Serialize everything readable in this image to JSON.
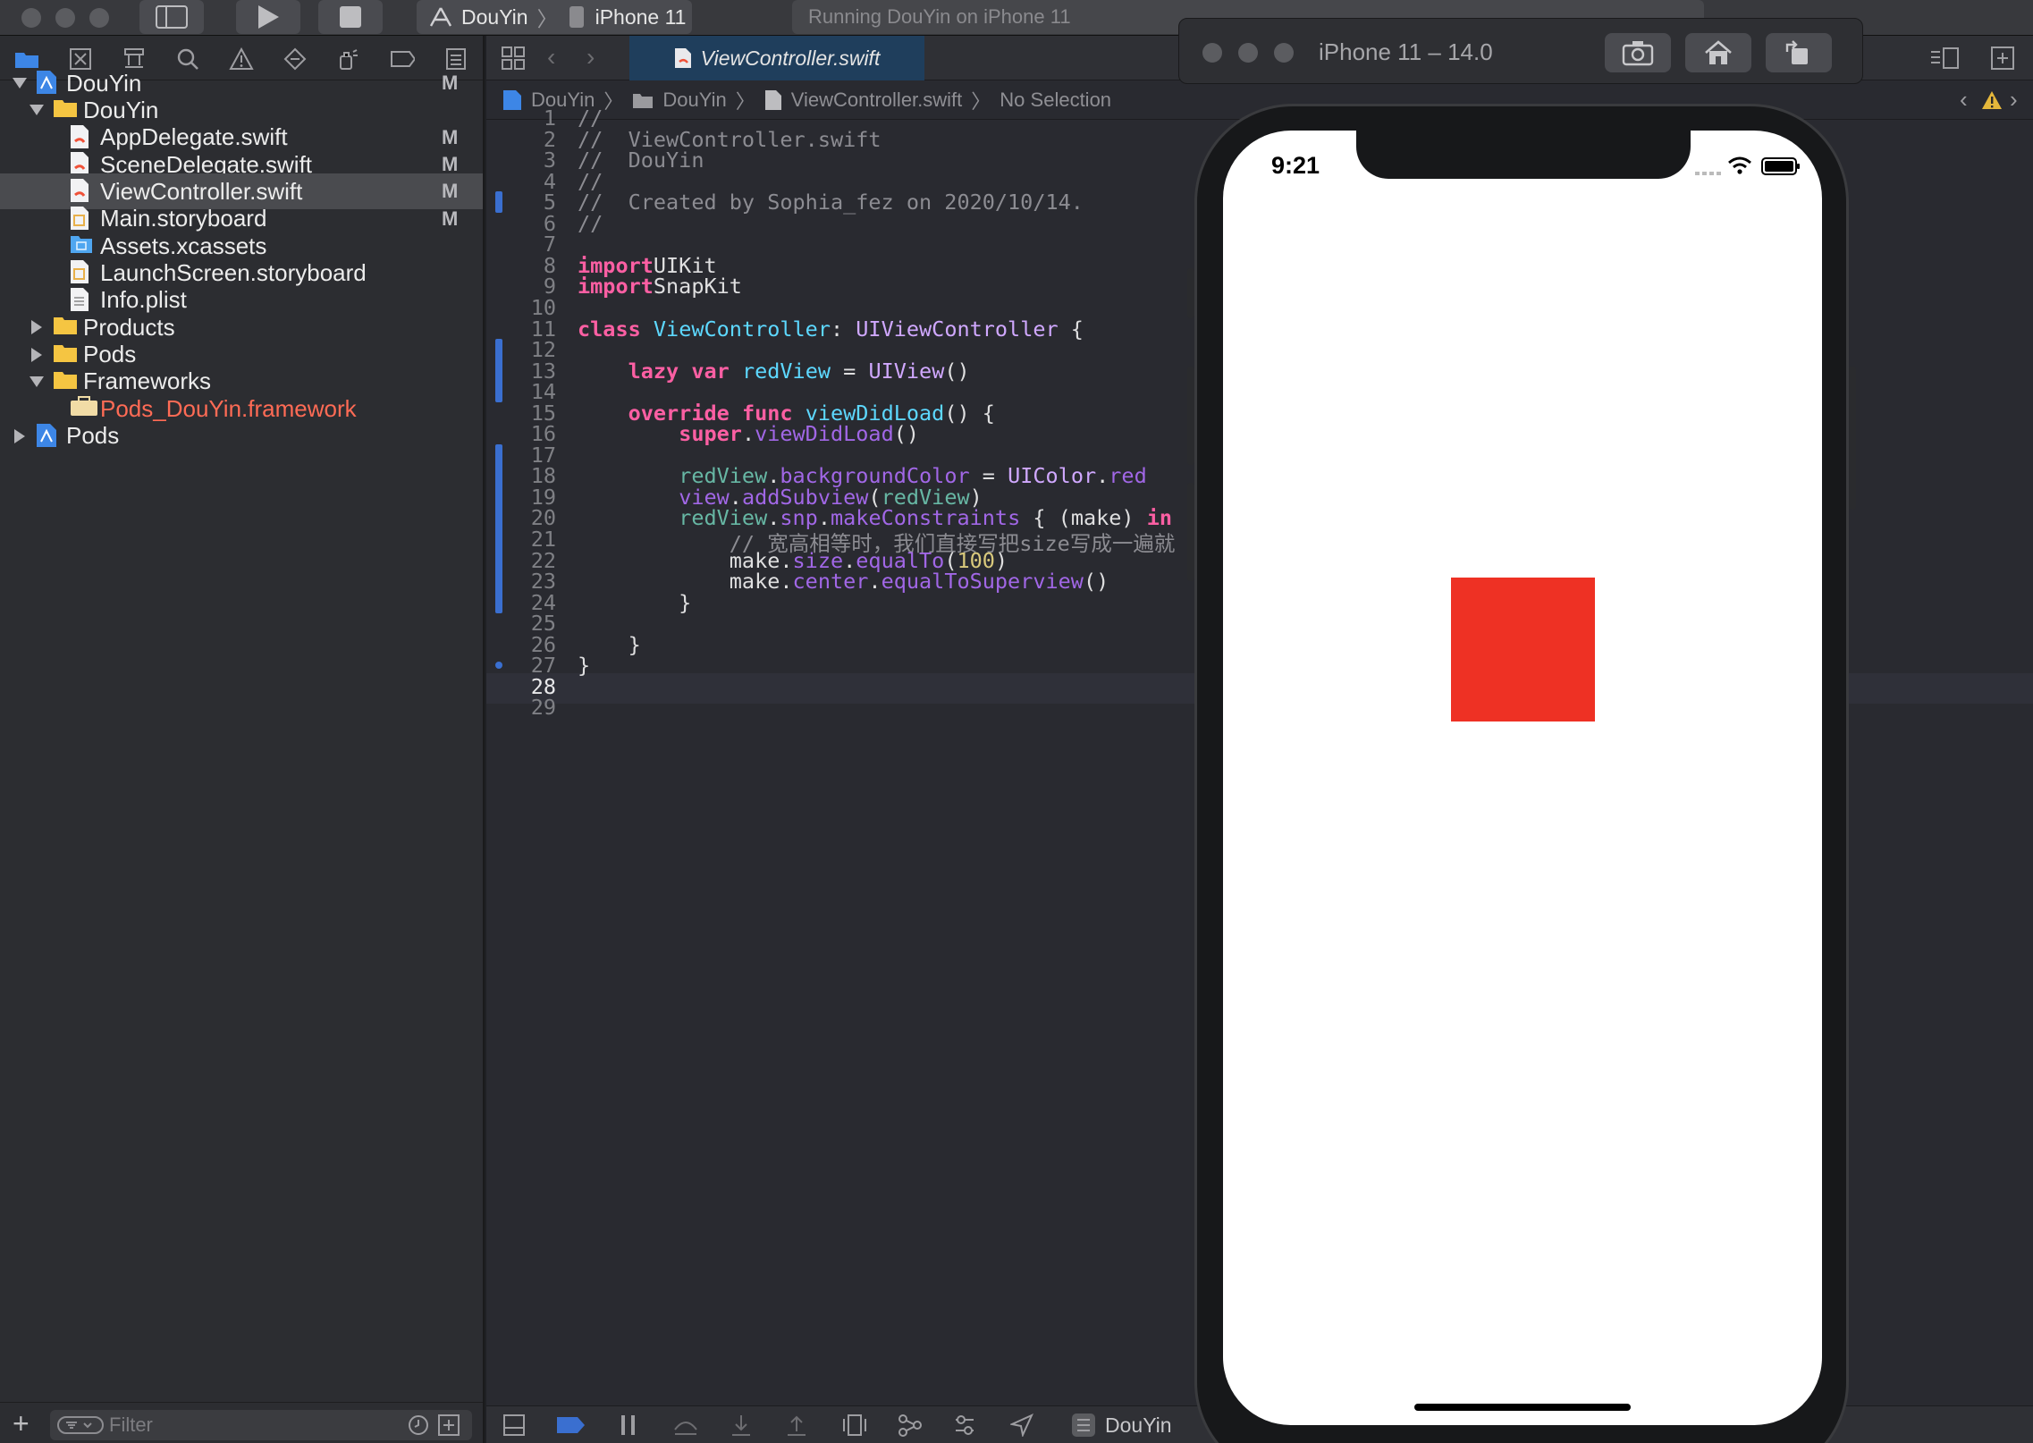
{
  "toolbar": {
    "scheme_project": "DouYin",
    "scheme_device": "iPhone 11",
    "status": "Running DouYin on iPhone 11"
  },
  "navigator": {
    "rows": [
      {
        "label": "DouYin",
        "badge": "M",
        "kind": "project",
        "disclosure": "open"
      },
      {
        "label": "DouYin",
        "badge": "",
        "kind": "folder",
        "disclosure": "open"
      },
      {
        "label": "AppDelegate.swift",
        "badge": "M",
        "kind": "swift",
        "disclosure": ""
      },
      {
        "label": "SceneDelegate.swift",
        "badge": "M",
        "kind": "swift",
        "disclosure": ""
      },
      {
        "label": "ViewController.swift",
        "badge": "M",
        "kind": "swift",
        "disclosure": "",
        "selected": true
      },
      {
        "label": "Main.storyboard",
        "badge": "M",
        "kind": "storyboard",
        "disclosure": ""
      },
      {
        "label": "Assets.xcassets",
        "badge": "",
        "kind": "assets",
        "disclosure": ""
      },
      {
        "label": "LaunchScreen.storyboard",
        "badge": "",
        "kind": "storyboard",
        "disclosure": ""
      },
      {
        "label": "Info.plist",
        "badge": "",
        "kind": "plist",
        "disclosure": ""
      },
      {
        "label": "Products",
        "badge": "",
        "kind": "folder",
        "disclosure": "closed"
      },
      {
        "label": "Pods",
        "badge": "",
        "kind": "folder",
        "disclosure": "closed"
      },
      {
        "label": "Frameworks",
        "badge": "",
        "kind": "folder",
        "disclosure": "open"
      },
      {
        "label": "Pods_DouYin.framework",
        "badge": "",
        "kind": "framework",
        "disclosure": "",
        "missing": true
      },
      {
        "label": "Pods",
        "badge": "",
        "kind": "project",
        "disclosure": "closed"
      }
    ],
    "filter_placeholder": "Filter"
  },
  "editor": {
    "tab": "ViewController.swift",
    "jumpbar": [
      "DouYin",
      "DouYin",
      "ViewController.swift",
      "No Selection"
    ],
    "current_line": 28,
    "lines": [
      [
        [
          "cm",
          "//"
        ]
      ],
      [
        [
          "cm",
          "//  ViewController.swift"
        ]
      ],
      [
        [
          "cm",
          "//  DouYin"
        ]
      ],
      [
        [
          "cm",
          "//"
        ]
      ],
      [
        [
          "cm",
          "//  Created by Sophia_fez on 2020/10/14."
        ]
      ],
      [
        [
          "cm",
          "//"
        ]
      ],
      [],
      [
        [
          "kw",
          "import"
        ],
        [
          "",
          "UIKit"
        ]
      ],
      [
        [
          "kw",
          "import"
        ],
        [
          "",
          "SnapKit"
        ]
      ],
      [],
      [
        [
          "kw",
          "class"
        ],
        [
          "",
          " "
        ],
        [
          "dec",
          "ViewController"
        ],
        [
          "",
          ": "
        ],
        [
          "ty",
          "UIViewController"
        ],
        [
          "",
          " {"
        ]
      ],
      [],
      [
        [
          "",
          "    "
        ],
        [
          "kw",
          "lazy"
        ],
        [
          "",
          " "
        ],
        [
          "kw",
          "var"
        ],
        [
          "",
          " "
        ],
        [
          "dec",
          "redView"
        ],
        [
          "",
          " = "
        ],
        [
          "ty",
          "UIView"
        ],
        [
          "",
          "()"
        ]
      ],
      [],
      [
        [
          "",
          "    "
        ],
        [
          "kw",
          "override"
        ],
        [
          "",
          " "
        ],
        [
          "kw",
          "func"
        ],
        [
          "",
          " "
        ],
        [
          "dec",
          "viewDidLoad"
        ],
        [
          "",
          "() {"
        ]
      ],
      [
        [
          "",
          "        "
        ],
        [
          "kw",
          "super"
        ],
        [
          "",
          "."
        ],
        [
          "pr",
          "viewDidLoad"
        ],
        [
          "",
          "()"
        ]
      ],
      [],
      [
        [
          "",
          "        "
        ],
        [
          "mt",
          "redView"
        ],
        [
          "",
          "."
        ],
        [
          "pr",
          "backgroundColor"
        ],
        [
          "",
          " = "
        ],
        [
          "ty",
          "UIColor"
        ],
        [
          "",
          "."
        ],
        [
          "pr",
          "red"
        ]
      ],
      [
        [
          "",
          "        "
        ],
        [
          "pr",
          "view"
        ],
        [
          "",
          "."
        ],
        [
          "pr",
          "addSubview"
        ],
        [
          "",
          "("
        ],
        [
          "mt",
          "redView"
        ],
        [
          "",
          ")"
        ]
      ],
      [
        [
          "",
          "        "
        ],
        [
          "mt",
          "redView"
        ],
        [
          "",
          "."
        ],
        [
          "pr",
          "snp"
        ],
        [
          "",
          "."
        ],
        [
          "pr",
          "makeConstraints"
        ],
        [
          "",
          " { (make) "
        ],
        [
          "kw",
          "in"
        ]
      ],
      [
        [
          "",
          "            "
        ],
        [
          "cm",
          "// 宽高相等时，我们直接写把size写成一遍就"
        ]
      ],
      [
        [
          "",
          "            "
        ],
        [
          "",
          "make."
        ],
        [
          "pr",
          "size"
        ],
        [
          "",
          "."
        ],
        [
          "pr",
          "equalTo"
        ],
        [
          "",
          "("
        ],
        [
          "nu",
          "100"
        ],
        [
          "",
          ")"
        ]
      ],
      [
        [
          "",
          "            "
        ],
        [
          "",
          "make."
        ],
        [
          "pr",
          "center"
        ],
        [
          "",
          "."
        ],
        [
          "pr",
          "equalToSuperview"
        ],
        [
          "",
          "()"
        ]
      ],
      [
        [
          "",
          "        }"
        ]
      ],
      [],
      [
        [
          "",
          "    }"
        ]
      ],
      [
        [
          "",
          "}"
        ]
      ],
      [],
      []
    ]
  },
  "debug": {
    "target": "DouYin"
  },
  "simulator": {
    "title": "iPhone 11 – 14.0",
    "time": "9:21",
    "red_view_color": "#ee3124",
    "red_view_size_pt": 100
  },
  "colors": {
    "accent": "#3a6fd0",
    "missing_file": "#ff6b55"
  }
}
